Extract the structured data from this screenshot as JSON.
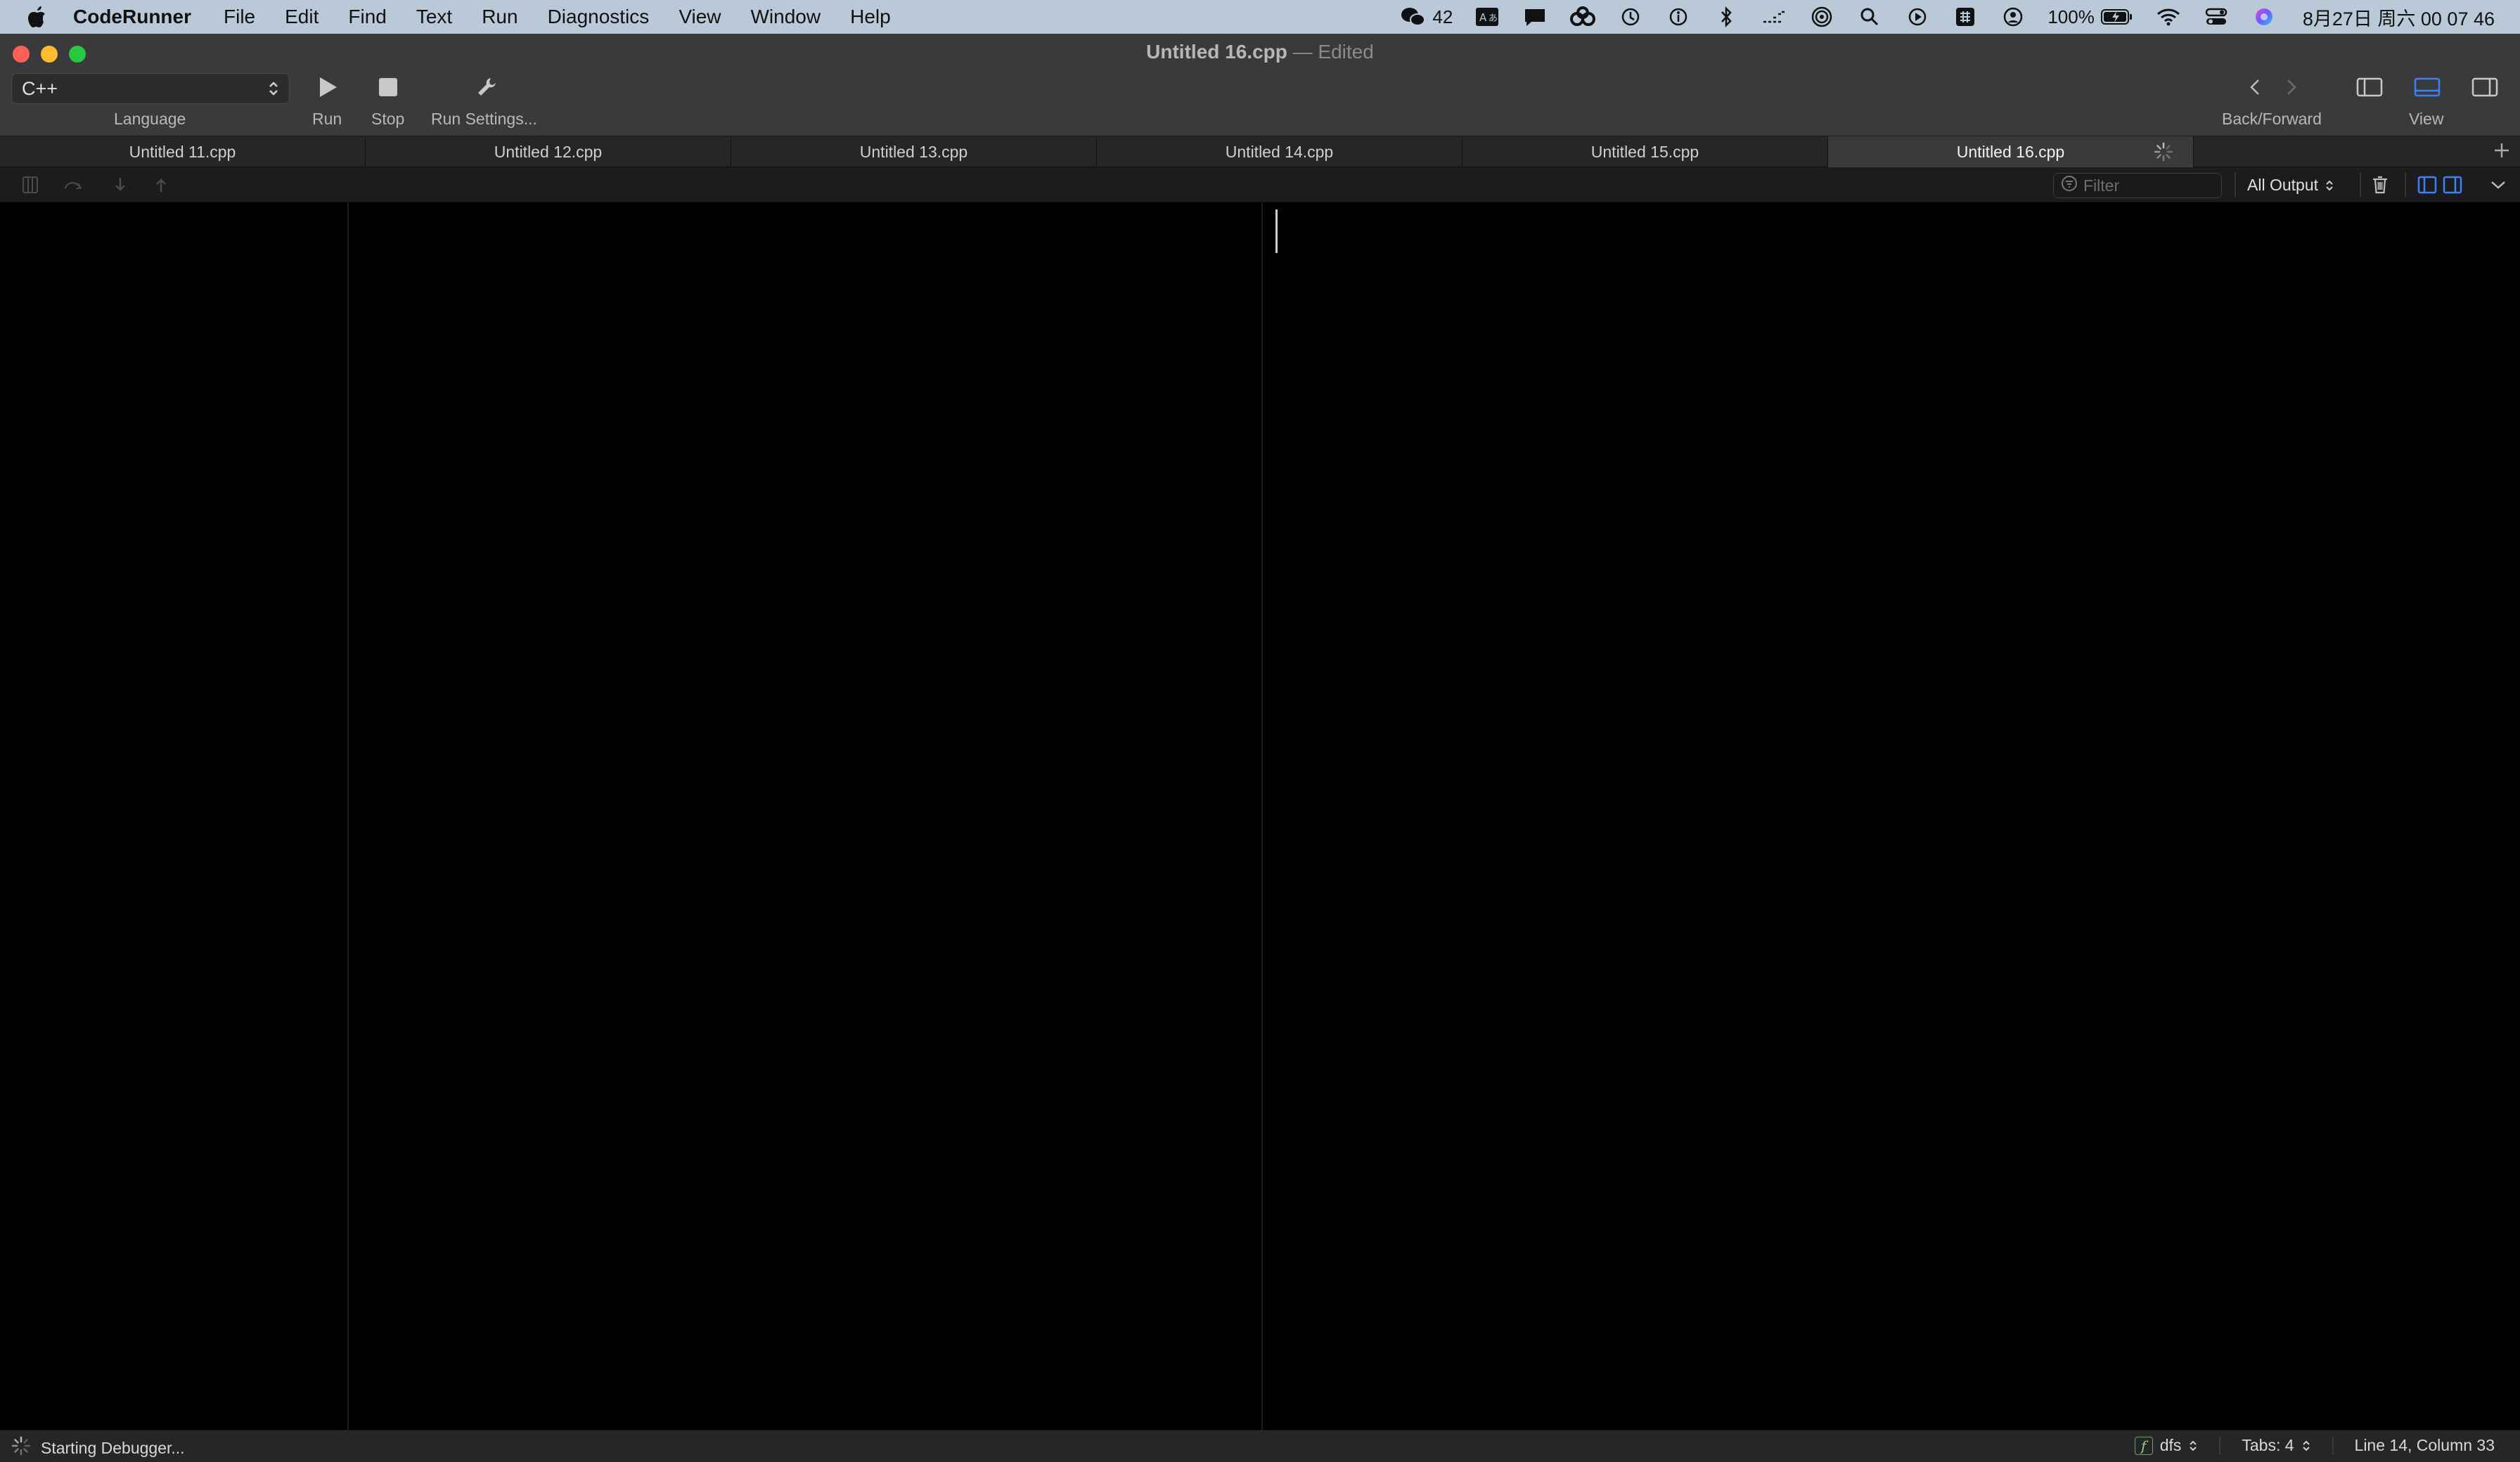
{
  "menubar": {
    "app_name": "CodeRunner",
    "items": [
      "File",
      "Edit",
      "Find",
      "Text",
      "Run",
      "Diagnostics",
      "View",
      "Window",
      "Help"
    ],
    "wechat_count": "42",
    "battery": "100%",
    "clock": "8月27日 周六  00 07 46"
  },
  "window": {
    "title": "Untitled 16.cpp",
    "title_separator": " — ",
    "edited": "Edited"
  },
  "toolbar": {
    "language_value": "C++",
    "language_label": "Language",
    "run_label": "Run",
    "stop_label": "Stop",
    "run_settings_label": "Run Settings...",
    "back_forward_label": "Back/Forward",
    "view_label": "View"
  },
  "tabs": [
    {
      "label": "Untitled 11.cpp"
    },
    {
      "label": "Untitled 12.cpp"
    },
    {
      "label": "Untitled 13.cpp"
    },
    {
      "label": "Untitled 14.cpp"
    },
    {
      "label": "Untitled 15.cpp"
    },
    {
      "label": "Untitled 16.cpp",
      "active": true
    }
  ],
  "debugbar": {
    "filter_placeholder": "Filter",
    "output_select": "All Output"
  },
  "statusbar": {
    "message": "Starting Debugger...",
    "function_name": "dfs",
    "tabs": "Tabs: 4",
    "position": "Line 14, Column 33"
  },
  "colors": {
    "accent": "#3b82f6",
    "titlebar": "#3a3a3c",
    "close": "#fe5f57",
    "minimize": "#febc2e",
    "zoom": "#28c840"
  }
}
